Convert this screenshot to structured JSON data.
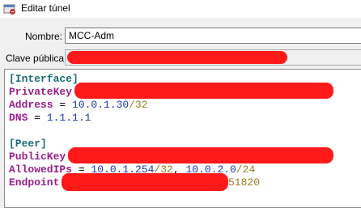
{
  "window": {
    "title": "Editar túnel",
    "icon": "wireguard-window-icon"
  },
  "form": {
    "name_label": "Nombre:",
    "name_value": "MCC-Adm",
    "public_key_label": "Clave pública:"
  },
  "config": {
    "interface_header": "[Interface]",
    "private_key_key": "PrivateKey",
    "address_key": "Address",
    "address_ip": "10.0.1.30",
    "address_mask": "/32",
    "dns_key": "DNS",
    "dns_value": "1.1.1.1",
    "peer_header": "[Peer]",
    "public_key_key": "PublicKey",
    "allowed_ips_key": "AllowedIPs",
    "allowed_ip1": "10.0.1.254",
    "allowed_mask1": "/32",
    "comma": ", ",
    "allowed_ip2": "10.0.2.0",
    "allowed_mask2": "/24",
    "endpoint_key": "Endpoint",
    "endpoint_port": "51820",
    "equals": " = "
  },
  "colors": {
    "section": "#1c6b7a",
    "key": "#9a1f8a",
    "value": "#1f3aa6",
    "cidr": "#9a7b1e",
    "redaction": "#ff1a1a"
  }
}
